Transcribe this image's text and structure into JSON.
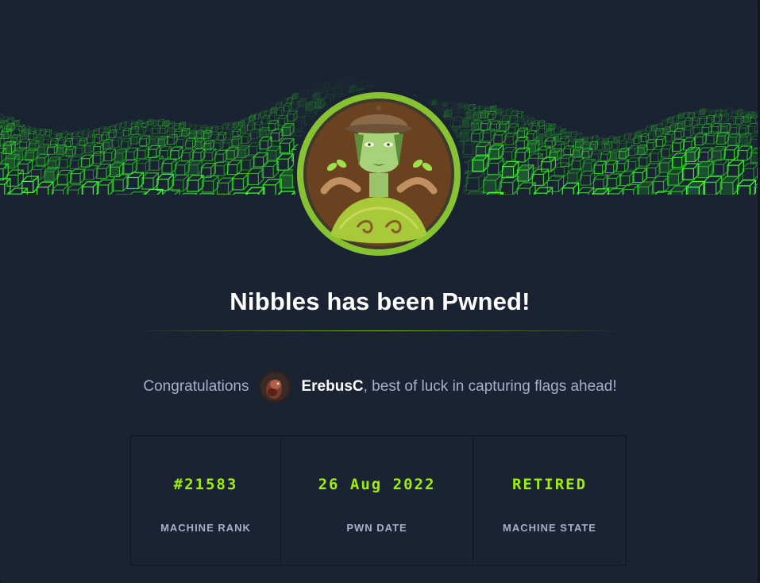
{
  "title": "Nibbles has been Pwned!",
  "congrats": {
    "prefix": "Congratulations",
    "username": "ErebusC",
    "suffix": ", best of luck in capturing flags ahead!"
  },
  "stats": [
    {
      "value": "#21583",
      "label": "MACHINE RANK"
    },
    {
      "value": "26 Aug 2022",
      "label": "PWN DATE"
    },
    {
      "value": "RETIRED",
      "label": "MACHINE STATE"
    }
  ],
  "colors": {
    "background": "#1a2332",
    "accent": "#9fef00",
    "muted_text": "#a4b1cd",
    "title_text": "#ffffff"
  },
  "icons": {
    "machine_avatar": "nibbles-machine-avatar",
    "user_avatar": "user-avatar",
    "banner": "green-cube-wave-banner"
  }
}
